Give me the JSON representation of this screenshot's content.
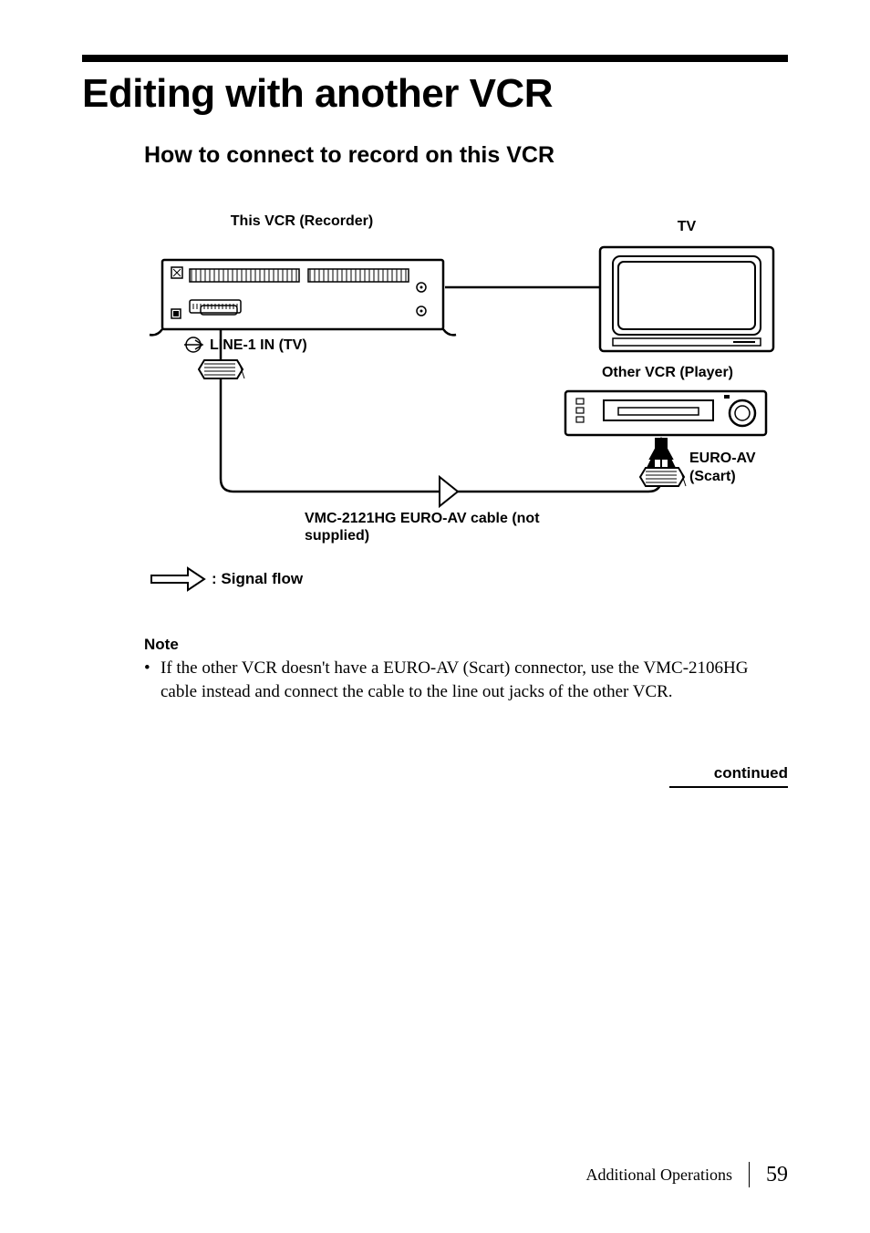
{
  "heading": "Editing with another VCR",
  "subheading": "How to connect to record on this VCR",
  "diagram": {
    "this_vcr_label": "This VCR (Recorder)",
    "tv_label": "TV",
    "other_vcr_label": "Other VCR (Player)",
    "line1_label": "LINE-1 IN (TV)",
    "euroav_label_line1": "EURO-AV",
    "euroav_label_line2": "(Scart)",
    "cable_label": "VMC-2121HG EURO-AV cable (not supplied)",
    "signal_flow_label": ":  Signal flow"
  },
  "note": {
    "heading": "Note",
    "body": "If the other VCR doesn't have a EURO-AV (Scart) connector, use the VMC-2106HG cable instead and connect the cable to the line out jacks of the other VCR."
  },
  "continued": "continued",
  "footer": {
    "section": "Additional Operations",
    "page": "59"
  }
}
